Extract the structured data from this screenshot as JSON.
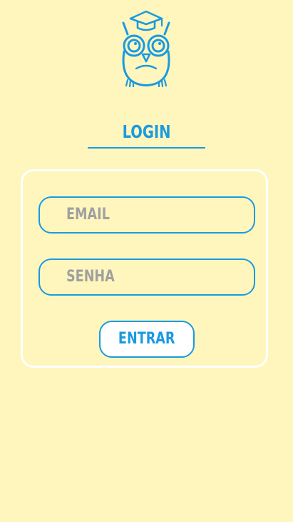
{
  "logo": {
    "icon": "owl-graduate-icon",
    "color": "#1a9ae0"
  },
  "title": "LOGIN",
  "form": {
    "email_placeholder": "EMAIL",
    "senha_placeholder": "SENHA",
    "submit_label": "ENTRAR"
  },
  "colors": {
    "background": "#fff6bd",
    "accent": "#1a9ae0",
    "card_border": "#ffffff",
    "placeholder": "#a0a0a0"
  }
}
